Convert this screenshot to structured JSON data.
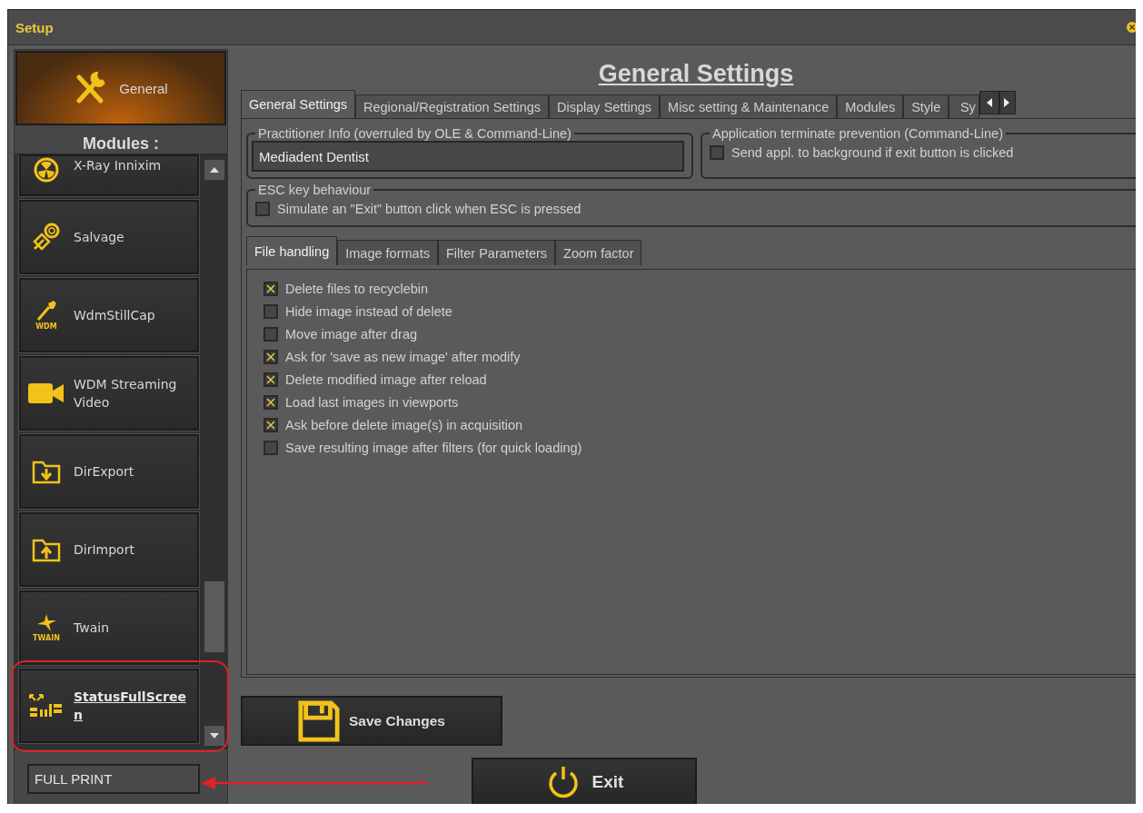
{
  "window": {
    "title": "Setup"
  },
  "sidebar": {
    "general_button": {
      "label": "General"
    },
    "modules_heading": "Modules :",
    "modules": [
      {
        "label": "X-Ray Innixim",
        "kind": "xray",
        "selected": false
      },
      {
        "label": "Salvage",
        "kind": "salvage",
        "selected": false
      },
      {
        "label": "WdmStillCap",
        "kind": "wdm",
        "icon_caption": "WDM",
        "selected": false
      },
      {
        "label": "WDM Streaming Video",
        "kind": "video",
        "selected": false
      },
      {
        "label": "DirExport",
        "kind": "export",
        "selected": false
      },
      {
        "label": "DirImport",
        "kind": "import",
        "selected": false
      },
      {
        "label": "Twain",
        "kind": "twain",
        "icon_caption": "TWAIN",
        "selected": false
      },
      {
        "label": "StatusFullScreen",
        "kind": "status",
        "selected": true
      }
    ],
    "name_field": {
      "value": "FULL PRINT"
    }
  },
  "page_title": "General Settings",
  "tabs": [
    {
      "label": "General Settings",
      "selected": true
    },
    {
      "label": "Regional/Registration Settings",
      "selected": false
    },
    {
      "label": "Display Settings",
      "selected": false
    },
    {
      "label": "Misc setting & Maintenance",
      "selected": false
    },
    {
      "label": "Modules",
      "selected": false
    },
    {
      "label": "Style",
      "selected": false
    },
    {
      "label": "Sy",
      "selected": false
    }
  ],
  "practitioner_group": {
    "legend": "Practitioner Info (overruled by OLE & Command-Line)",
    "value": "Mediadent Dentist"
  },
  "terminate_group": {
    "legend": "Application terminate prevention (Command-Line)",
    "option": {
      "label": "Send appl. to background if exit button is clicked",
      "checked": false
    }
  },
  "esc_group": {
    "legend": "ESC key behaviour",
    "option": {
      "label": "Simulate an \"Exit\" button click when ESC is pressed",
      "checked": false
    }
  },
  "sub_tabs": [
    {
      "label": "File handling",
      "selected": true
    },
    {
      "label": "Image formats",
      "selected": false
    },
    {
      "label": "Filter Parameters",
      "selected": false
    },
    {
      "label": "Zoom factor",
      "selected": false
    }
  ],
  "file_options": [
    {
      "label": "Delete files to recyclebin",
      "checked": true
    },
    {
      "label": "Hide image instead of delete",
      "checked": false
    },
    {
      "label": "Move image after drag",
      "checked": false
    },
    {
      "label": "Ask for 'save as new image' after modify",
      "checked": true
    },
    {
      "label": "Delete modified image after reload",
      "checked": true
    },
    {
      "label": "Load last images in viewports",
      "checked": true
    },
    {
      "label": "Ask before delete image(s) in acquisition",
      "checked": true
    },
    {
      "label": "Save resulting image after filters (for quick loading)",
      "checked": false
    }
  ],
  "buttons": {
    "save": "Save Changes",
    "exit": "Exit"
  }
}
